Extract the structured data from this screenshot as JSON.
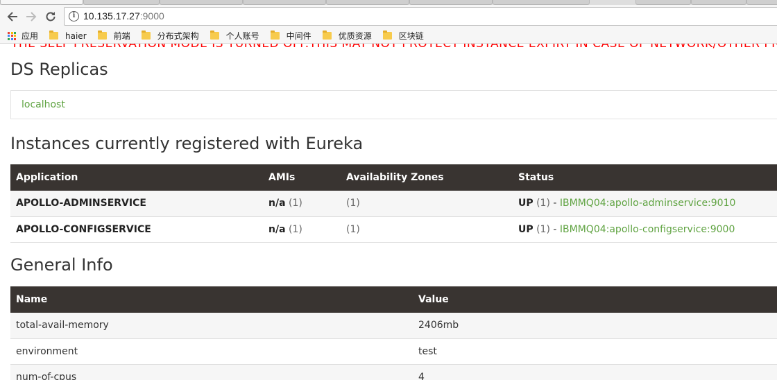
{
  "browser": {
    "url_host": "10.135.17.27",
    "url_port": ":9000",
    "bookmarks": {
      "apps_label": "应用",
      "folders": [
        "haier",
        "前端",
        "分布式架构",
        "个人账号",
        "中间件",
        "优质资源",
        "区块链"
      ]
    }
  },
  "page": {
    "warning": "THE SELF PRESERVATION MODE IS TURNED OFF.THIS MAY NOT PROTECT INSTANCE EXPIRY IN CASE OF NETWORK/OTHER PROBLEMS.",
    "ds_replicas": {
      "title": "DS Replicas",
      "host": "localhost"
    },
    "instances": {
      "title": "Instances currently registered with Eureka",
      "headers": [
        "Application",
        "AMIs",
        "Availability Zones",
        "Status"
      ],
      "rows": [
        {
          "application": "APOLLO-ADMINSERVICE",
          "amis": "n/a",
          "amis_count": "(1)",
          "zones": "(1)",
          "status": "UP",
          "status_count": "(1)",
          "separator": "-",
          "instance": "IBMMQ04:apollo-adminservice:9010"
        },
        {
          "application": "APOLLO-CONFIGSERVICE",
          "amis": "n/a",
          "amis_count": "(1)",
          "zones": "(1)",
          "status": "UP",
          "status_count": "(1)",
          "separator": "-",
          "instance": "IBMMQ04:apollo-configservice:9000"
        }
      ]
    },
    "general_info": {
      "title": "General Info",
      "headers": [
        "Name",
        "Value"
      ],
      "rows": [
        {
          "name": "total-avail-memory",
          "value": "2406mb"
        },
        {
          "name": "environment",
          "value": "test"
        },
        {
          "name": "num-of-cpus",
          "value": "4"
        }
      ]
    }
  },
  "colors": {
    "warning": "#ff0000",
    "table_header_bg": "#393431",
    "link": "#5fa341"
  }
}
